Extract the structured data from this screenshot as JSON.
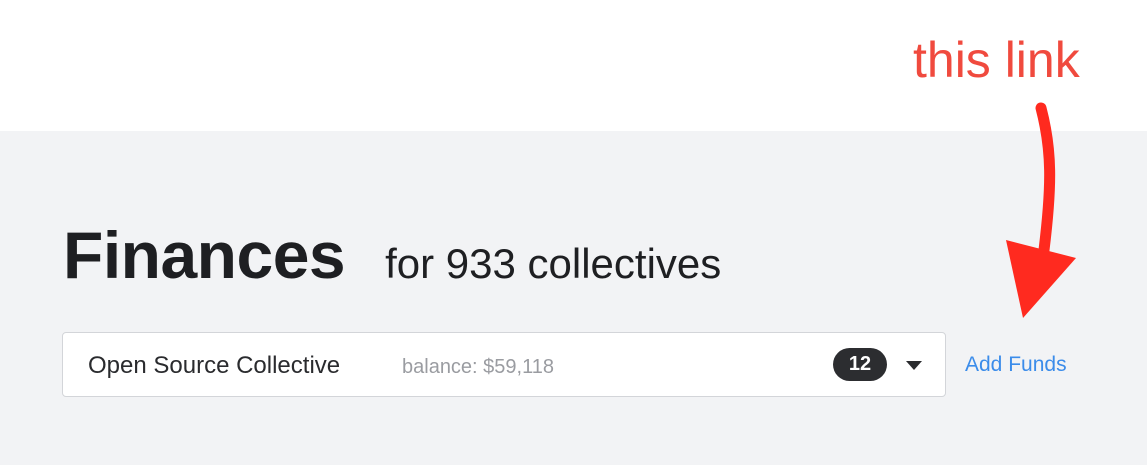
{
  "annotation": {
    "text": "this link",
    "color": "#f04a3e"
  },
  "header": {
    "title": "Finances",
    "subtitle": "for 933 collectives"
  },
  "collective_select": {
    "selected_name": "Open Source Collective",
    "balance_text": "balance: $59,118",
    "count_badge": "12",
    "caret_icon": "caret-down-icon"
  },
  "actions": {
    "add_funds_label": "Add Funds",
    "link_color": "#3b8cea"
  },
  "colors": {
    "background_top": "#ffffff",
    "background_main": "#f2f3f5",
    "text_primary": "#1e1f22",
    "text_muted": "#9a9ca1",
    "badge_bg": "#2c2d30"
  }
}
